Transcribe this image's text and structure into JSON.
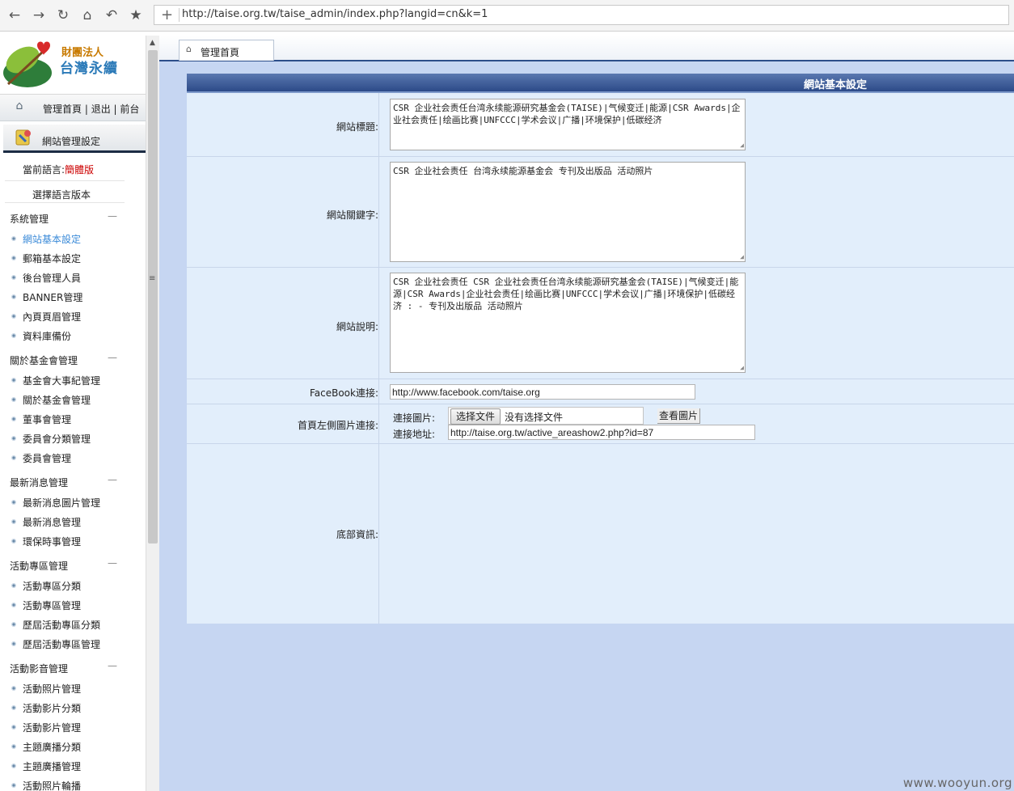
{
  "browser": {
    "url": "http://taise.org.tw/taise_admin/index.php?langid=cn&k=1",
    "icons": [
      "back-icon",
      "forward-icon",
      "reload-icon",
      "home-icon",
      "undo-icon",
      "star-icon",
      "plus-icon"
    ]
  },
  "sidebar": {
    "logo": {
      "small": "財團法人",
      "big": "台灣永續"
    },
    "top_links": {
      "home": "管理首頁",
      "logout": "退出",
      "front": "前台"
    },
    "section_title": "網站管理設定",
    "lang_label": "當前語言:",
    "lang_value": "簡體版",
    "lang_select": "選擇語言版本",
    "groups": [
      {
        "title": "系統管理",
        "items": [
          "網站基本設定",
          "郵箱基本設定",
          "後台管理人員",
          "BANNER管理",
          "內頁頁眉管理",
          "資料庫備份"
        ]
      },
      {
        "title": "關於基金會管理",
        "items": [
          "基金會大事紀管理",
          "關於基金會管理",
          "董事會管理",
          "委員會分類管理",
          "委員會管理"
        ]
      },
      {
        "title": "最新消息管理",
        "items": [
          "最新消息圖片管理",
          "最新消息管理",
          "環保時事管理"
        ]
      },
      {
        "title": "活動專區管理",
        "items": [
          "活動專區分類",
          "活動專區管理",
          "歷屆活動專區分類",
          "歷屆活動專區管理"
        ]
      },
      {
        "title": "活動影音管理",
        "items": [
          "活動照片管理",
          "活動影片分類",
          "活動影片管理",
          "主題廣播分類",
          "主題廣播管理",
          "活動照片輪播"
        ]
      }
    ]
  },
  "tab": {
    "label": "管理首頁"
  },
  "panel": {
    "title": "網站基本設定",
    "site_title": {
      "label": "網站標題:",
      "value": "CSR 企业社会责任台湾永续能源研究基金会(TAISE)|气候变迁|能源|CSR Awards|企业社会责任|绘画比赛|UNFCCC|学术会议|广播|环境保护|低碳经济"
    },
    "site_keywords": {
      "label": "網站關鍵字:",
      "value": "CSR 企业社会责任 台湾永续能源基金会 专刊及出版品 活动照片"
    },
    "site_desc": {
      "label": "網站說明:",
      "value": "CSR 企业社会责任 CSR 企业社会责任台湾永续能源研究基金会(TAISE)|气候变迁|能源|CSR Awards|企业社会责任|绘画比赛|UNFCCC|学术会议|广播|环境保护|低碳经济 : - 专刊及出版品 活动照片"
    },
    "facebook": {
      "label": "FaceBook連接:",
      "value": "http://www.facebook.com/taise.org"
    },
    "left_image": {
      "label": "首頁左側圖片連接:",
      "image_label": "連接圖片:",
      "file_button": "选择文件",
      "file_none": "没有选择文件",
      "view_button": "查看圖片",
      "url_label": "連接地址:",
      "url_value": "http://taise.org.tw/active_areashow2.php?id=87"
    },
    "footer_info": {
      "label": "底部資訊:"
    }
  },
  "watermark": "www.wooyun.org"
}
